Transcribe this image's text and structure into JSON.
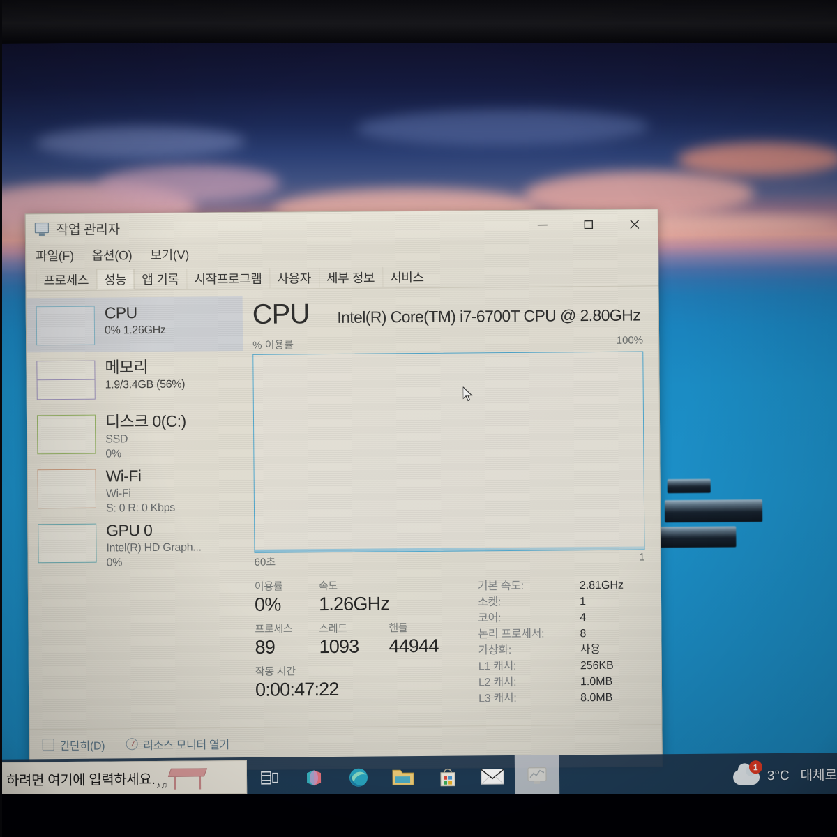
{
  "window": {
    "title": "작업 관리자",
    "icon": "task-manager-icon",
    "controls": {
      "minimize": "—",
      "maximize": "□",
      "close": "✕"
    }
  },
  "menu": [
    {
      "label": "파일(F)"
    },
    {
      "label": "옵션(O)"
    },
    {
      "label": "보기(V)"
    }
  ],
  "tabs": [
    {
      "label": "프로세스",
      "selected": false
    },
    {
      "label": "성능",
      "selected": true
    },
    {
      "label": "앱 기록",
      "selected": false
    },
    {
      "label": "시작프로그램",
      "selected": false
    },
    {
      "label": "사용자",
      "selected": false
    },
    {
      "label": "세부 정보",
      "selected": false
    },
    {
      "label": "서비스",
      "selected": false
    }
  ],
  "sidebar": [
    {
      "title": "CPU",
      "sub1": "0% 1.26GHz",
      "sub2": "",
      "selected": true,
      "color": "#6fa8bd"
    },
    {
      "title": "메모리",
      "sub1": "1.9/3.4GB (56%)",
      "sub2": "",
      "selected": false,
      "color": "#8b7fb0"
    },
    {
      "title": "디스크 0(C:)",
      "sub1": "SSD",
      "sub2": "0%",
      "selected": false,
      "color": "#86a84f"
    },
    {
      "title": "Wi-Fi",
      "sub1": "Wi-Fi",
      "sub2": "S: 0 R: 0 Kbps",
      "selected": false,
      "color": "#c08a6a"
    },
    {
      "title": "GPU 0",
      "sub1": "Intel(R) HD Graph...",
      "sub2": "0%",
      "selected": false,
      "color": "#56a0a8"
    }
  ],
  "main": {
    "heading": "CPU",
    "model": "Intel(R) Core(TM) i7-6700T CPU @ 2.80GHz",
    "graph_title": "% 이용률",
    "graph_max": "100%",
    "graph_time_left": "60초",
    "graph_time_right": "1",
    "stats": {
      "utilization_label": "이용률",
      "utilization_value": "0%",
      "speed_label": "속도",
      "speed_value": "1.26GHz",
      "processes_label": "프로세스",
      "processes_value": "89",
      "threads_label": "스레드",
      "threads_value": "1093",
      "handles_label": "핸들",
      "handles_value": "44944",
      "uptime_label": "작동 시간",
      "uptime_value": "0:00:47:22"
    },
    "specs": [
      {
        "key": "기본 속도:",
        "value": "2.81GHz"
      },
      {
        "key": "소켓:",
        "value": "1"
      },
      {
        "key": "코어:",
        "value": "4"
      },
      {
        "key": "논리 프로세서:",
        "value": "8"
      },
      {
        "key": "가상화:",
        "value": "사용"
      },
      {
        "key": "L1 캐시:",
        "value": "256KB"
      },
      {
        "key": "L2 캐시:",
        "value": "1.0MB"
      },
      {
        "key": "L3 캐시:",
        "value": "8.0MB"
      }
    ]
  },
  "footer": {
    "fewer_details": "간단히(D)",
    "resource_monitor": "리소스 모니터 열기"
  },
  "taskbar": {
    "search_placeholder": "하려면 여기에 입력하세요.",
    "task_view": "task-view-icon",
    "apps": [
      {
        "name": "office-teams-icon",
        "active": false
      },
      {
        "name": "edge-browser-icon",
        "active": false
      },
      {
        "name": "file-explorer-icon",
        "active": false
      },
      {
        "name": "microsoft-store-icon",
        "active": false
      },
      {
        "name": "mail-icon",
        "active": false
      },
      {
        "name": "task-manager-taskbar-icon",
        "active": true
      }
    ],
    "weather": {
      "temperature": "3°C",
      "condition": "대체로",
      "badge": "1"
    }
  },
  "chart_data": {
    "type": "line",
    "title": "% 이용률",
    "xlabel": "",
    "ylabel": "",
    "ylim": [
      0,
      100
    ],
    "x_axis_left_label": "60초",
    "x_axis_right_label": "1",
    "y_axis_max_label": "100%",
    "series": [
      {
        "name": "CPU 이용률",
        "values": [
          0,
          0,
          0,
          0,
          0,
          0,
          0,
          0,
          0,
          0,
          0,
          0,
          0,
          0,
          0,
          0,
          0,
          0,
          0,
          0,
          0,
          0,
          0,
          0,
          0,
          0,
          0,
          0,
          0,
          0,
          0,
          0,
          0,
          0,
          0,
          0,
          0,
          0,
          0,
          0,
          0,
          0,
          0,
          0,
          0,
          0,
          0,
          0,
          0,
          0,
          0,
          0,
          0,
          0,
          0,
          0,
          0,
          0,
          0,
          0
        ],
        "color": "#3f9fc9"
      }
    ],
    "grid": false,
    "legend": "none"
  }
}
